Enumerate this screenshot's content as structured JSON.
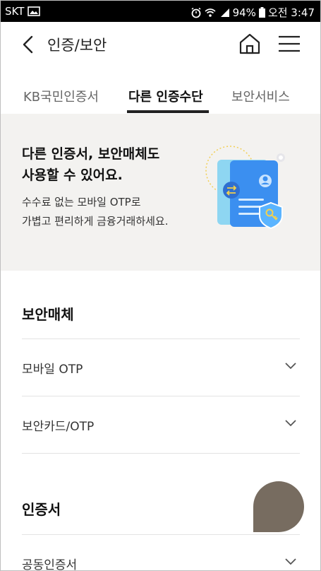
{
  "status_bar": {
    "carrier": "SKT",
    "battery": "94%",
    "time": "오전 3:47"
  },
  "header": {
    "title": "인증/보안"
  },
  "tabs": [
    {
      "label": "KB국민인증서"
    },
    {
      "label": "다른 인증수단"
    },
    {
      "label": "보안서비스"
    }
  ],
  "banner": {
    "title_line1": "다른 인증서, 보안매체도",
    "title_line2": "사용할 수 있어요.",
    "desc_line1": "수수료 없는 모바일 OTP로",
    "desc_line2": "가볍고 편리하게 금융거래하세요."
  },
  "sections": [
    {
      "heading": "보안매체",
      "items": [
        {
          "label": "모바일 OTP"
        },
        {
          "label": "보안카드/OTP"
        }
      ]
    },
    {
      "heading": "인증서",
      "items": [
        {
          "label": "공동인증서"
        }
      ]
    }
  ],
  "colors": {
    "fab": "#776c60",
    "banner_bg": "#f3f2f0",
    "accent_blue": "#3b8ff0"
  }
}
